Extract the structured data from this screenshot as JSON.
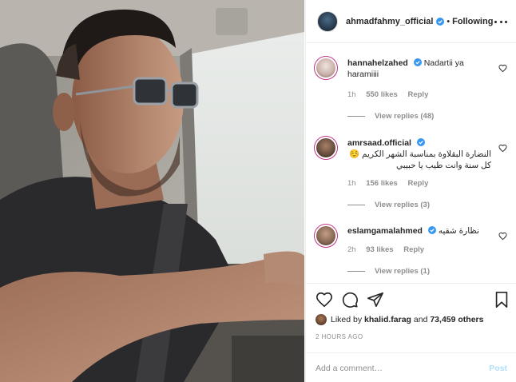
{
  "post": {
    "photo_alt": "",
    "author": {
      "username": "ahmadfahmy_official",
      "verified": true
    },
    "follow_status": "Following",
    "dot": "•"
  },
  "comments": [
    {
      "username": "hannahelzahed",
      "verified": true,
      "text": "Nadartii ya haramiiii",
      "time": "1h",
      "likes": "550 likes",
      "reply_label": "Reply",
      "view_replies": "View replies (48)",
      "avatar_color": "#d8c6c2"
    },
    {
      "username": "amrsaad.official",
      "verified": true,
      "text": "النضارة البقلاوة بمناسبة الشهر الكريم ☺️كل سنة وانت طيب يا حبيبي",
      "time": "1h",
      "likes": "156 likes",
      "reply_label": "Reply",
      "view_replies": "View replies (3)",
      "avatar_color": "#6b5140"
    },
    {
      "username": "eslamgamalahmed",
      "verified": true,
      "text": "نظارة شقيه",
      "time": "2h",
      "likes": "93 likes",
      "reply_label": "Reply",
      "view_replies": "View replies (1)",
      "avatar_color": "#8a6b58"
    }
  ],
  "actions": {
    "like_icon": "heart-icon",
    "comment_icon": "comment-icon",
    "share_icon": "paper-plane-icon",
    "save_icon": "bookmark-icon"
  },
  "likes": {
    "prefix": "Liked by",
    "user": "khalid.farag",
    "conjunction": "and",
    "others": "73,459 others"
  },
  "timestamp": "2 HOURS AGO",
  "add_comment": {
    "placeholder": "Add a comment…",
    "post_label": "Post"
  },
  "colors": {
    "verified_blue": "#3897f0",
    "post_disabled": "#b2dffc",
    "story_ring": "#c13584"
  }
}
